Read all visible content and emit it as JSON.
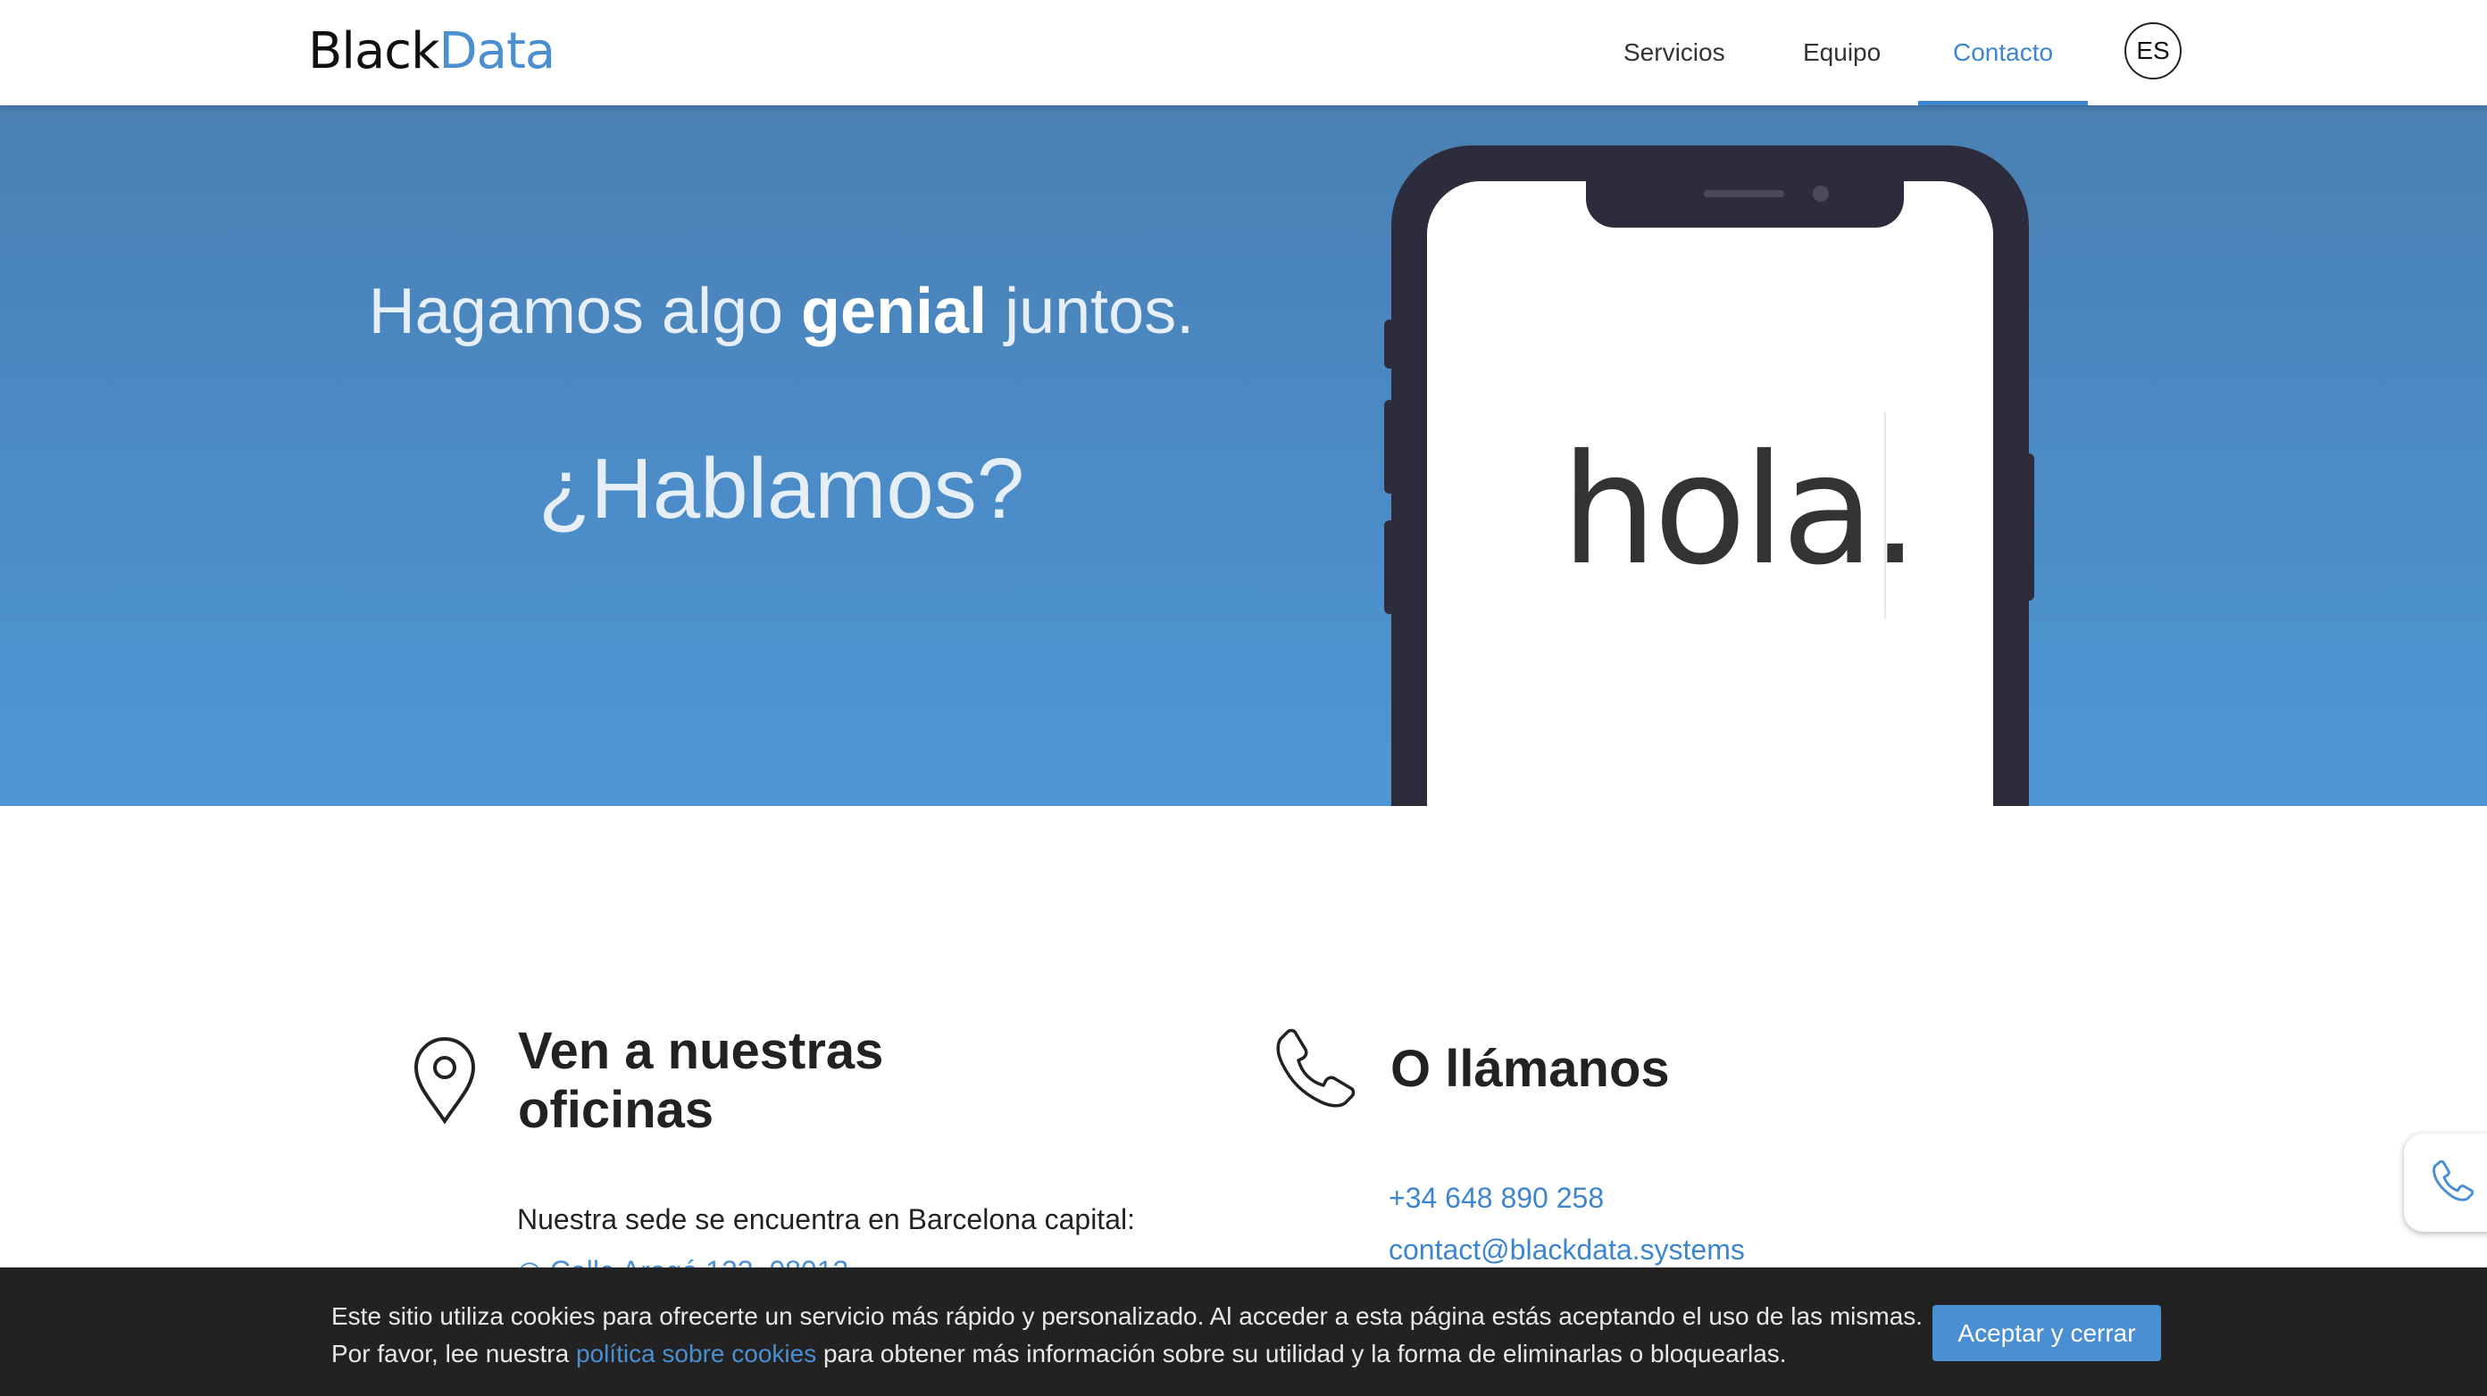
{
  "header": {
    "logo_black": "Black",
    "logo_data": "Data",
    "nav": [
      {
        "label": "Servicios",
        "active": false
      },
      {
        "label": "Equipo",
        "active": false
      },
      {
        "label": "Contacto",
        "active": true
      }
    ],
    "language": "ES"
  },
  "hero": {
    "tagline_start": "Hagamos algo ",
    "tagline_bold": "genial",
    "tagline_end": " juntos.",
    "question": "¿Hablamos?",
    "phone_text": "hola."
  },
  "offices": {
    "title_line1": "Ven a nuestras",
    "title_line2": "oficinas",
    "description": "Nuestra sede se encuentra en Barcelona capital:",
    "address": "Calle Aragó 123, 08013",
    "icon": "location-pin-icon"
  },
  "call": {
    "title": "O llámanos",
    "phone": "+34 648 890 258",
    "email": "contact@blackdata.systems",
    "icon": "phone-icon"
  },
  "cookie_banner": {
    "line1": "Este sitio utiliza cookies para ofrecerte un servicio más rápido y personalizado. Al acceder a esta página estás aceptando el uso de las mismas.",
    "line2_start": "Por favor, lee nuestra ",
    "line2_link": "política sobre cookies",
    "line2_end": " para obtener más información sobre su utilidad y la forma de eliminarlas o bloquearlas.",
    "accept_label": "Aceptar y cerrar"
  },
  "colors": {
    "accent": "#4a8fd1",
    "hero_top": "#4a80b2",
    "hero_bottom": "#4f97d3",
    "phone_body": "#2c2c3c",
    "cookie_bg": "#222222"
  }
}
